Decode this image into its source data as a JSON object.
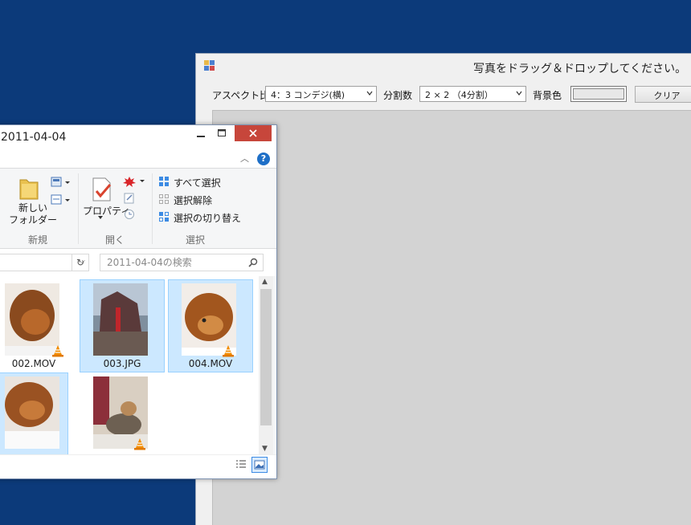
{
  "photo_app": {
    "title": "写真をドラッグ＆ドロップしてください。",
    "toolbar": {
      "aspect_label": "アスペクト比",
      "aspect_value": "4：3 コンデジ(横)",
      "split_label": "分割数",
      "split_value": "2 × 2 （4分割）",
      "bgcolor_label": "背景色",
      "bgcolor_value": "#e7e7e7",
      "clear_label": "クリア"
    }
  },
  "explorer": {
    "title": "2011-04-04",
    "ribbon": {
      "groups": {
        "new": {
          "label": "新規",
          "new_folder": "新しい\nフォルダー"
        },
        "open": {
          "label": "開く",
          "properties": "プロパティ"
        },
        "select": {
          "label": "選択",
          "select_all": "すべて選択",
          "select_none": "選択解除",
          "invert": "選択の切り替え"
        }
      }
    },
    "search_placeholder": "2011-04-04の検索",
    "files": [
      {
        "name": "002.MOV",
        "selected": false,
        "vlc": true
      },
      {
        "name": "003.JPG",
        "selected": true,
        "vlc": false
      },
      {
        "name": "004.MOV",
        "selected": true,
        "vlc": true
      },
      {
        "name": "",
        "selected": true,
        "vlc": false
      },
      {
        "name": "",
        "selected": false,
        "vlc": true
      }
    ]
  },
  "colors": {
    "desktop": "#0c3a7a",
    "close_button": "#c7463b",
    "selection": "#cce8ff",
    "canvas": "#d3d3d3"
  }
}
